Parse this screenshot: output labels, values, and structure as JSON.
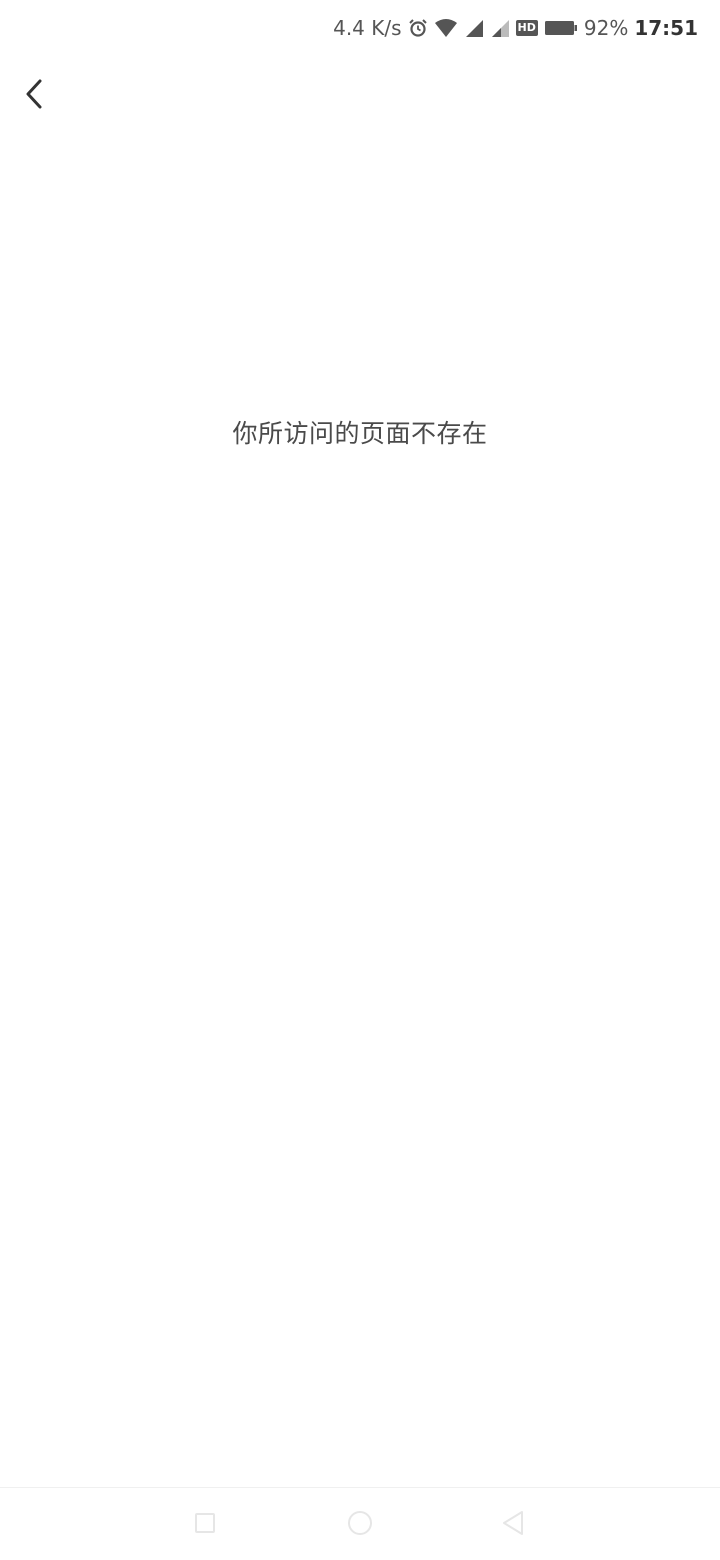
{
  "status_bar": {
    "network_speed": "4.4 K/s",
    "battery_percent": "92%",
    "time": "17:51",
    "hd_label": "HD",
    "icons": [
      "alarm-icon",
      "wifi-icon",
      "signal-icon",
      "signal-weak-icon",
      "hd-icon",
      "battery-icon"
    ]
  },
  "toolbar": {
    "back_icon": "chevron-left-icon"
  },
  "main": {
    "message": "你所访问的页面不存在"
  },
  "nav_bar": {
    "recents_icon": "square-icon",
    "home_icon": "circle-icon",
    "back_icon": "triangle-back-icon"
  },
  "colors": {
    "background": "#ffffff",
    "text": "#4a4a4a",
    "nav_icons": "#e6e6e6"
  }
}
